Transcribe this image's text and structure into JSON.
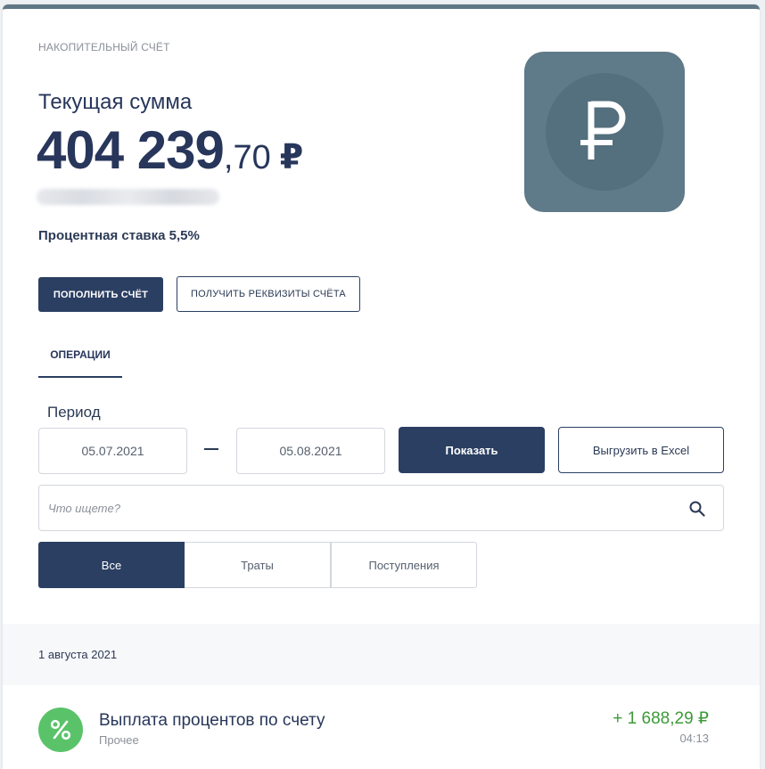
{
  "account": {
    "type_label": "НАКОПИТЕЛЬНЫЙ СЧЁТ",
    "current_label": "Текущая сумма",
    "balance_int": "404 239",
    "balance_frac": ",70",
    "currency": "₽",
    "rate_label": "Процентная ставка 5,5%"
  },
  "actions": {
    "topup_label": "ПОПОЛНИТЬ СЧЁТ",
    "details_label": "ПОЛУЧИТЬ РЕКВИЗИТЫ СЧЁТА"
  },
  "tabs": {
    "operations_label": "ОПЕРАЦИИ"
  },
  "filter": {
    "period_label": "Период",
    "date_from": "05.07.2021",
    "date_to": "05.08.2021",
    "show_label": "Показать",
    "excel_label": "Выгрузить в Excel",
    "search_placeholder": "Что ищете?",
    "segments": {
      "all": "Все",
      "spend": "Траты",
      "income": "Поступления"
    }
  },
  "transactions": {
    "group_date": "1 августа 2021",
    "items": [
      {
        "title": "Выплата процентов по счету",
        "category": "Прочее",
        "amount": "+ 1 688,29 ₽",
        "time": "04:13"
      }
    ]
  },
  "colors": {
    "primary": "#2b3f62",
    "tile": "#5f7a88",
    "success": "#5ac36a",
    "amount_positive": "#3c9a38"
  }
}
